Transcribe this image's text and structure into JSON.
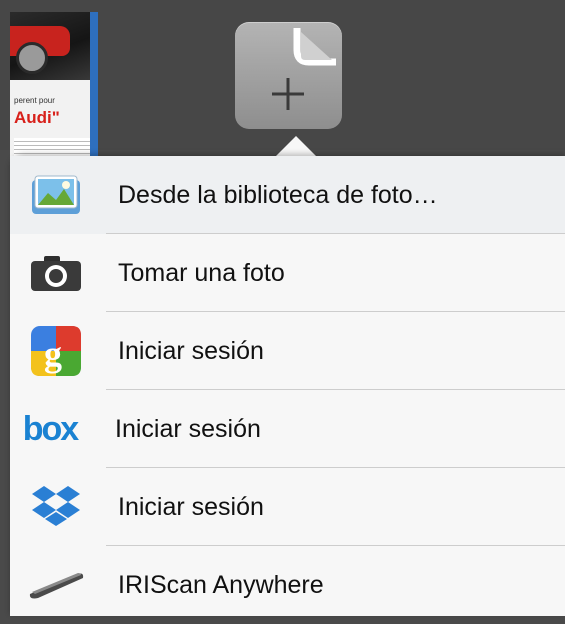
{
  "thumbnail": {
    "tagline": "perent pour",
    "brand": "Audi\""
  },
  "toolbar": {
    "new_document_icon": "add-document-icon"
  },
  "menu": {
    "items": [
      {
        "id": "photo-library",
        "label": "Desde la biblioteca de foto…",
        "icon": "photo-library-icon"
      },
      {
        "id": "take-photo",
        "label": "Tomar una foto",
        "icon": "camera-icon"
      },
      {
        "id": "google",
        "label": "Iniciar sesión",
        "icon": "google-icon"
      },
      {
        "id": "box",
        "label": "Iniciar sesión",
        "icon": "box-icon",
        "icon_text": "box"
      },
      {
        "id": "dropbox",
        "label": "Iniciar sesión",
        "icon": "dropbox-icon"
      },
      {
        "id": "iriscan",
        "label": "IRIScan Anywhere",
        "icon": "scanner-icon"
      }
    ]
  }
}
